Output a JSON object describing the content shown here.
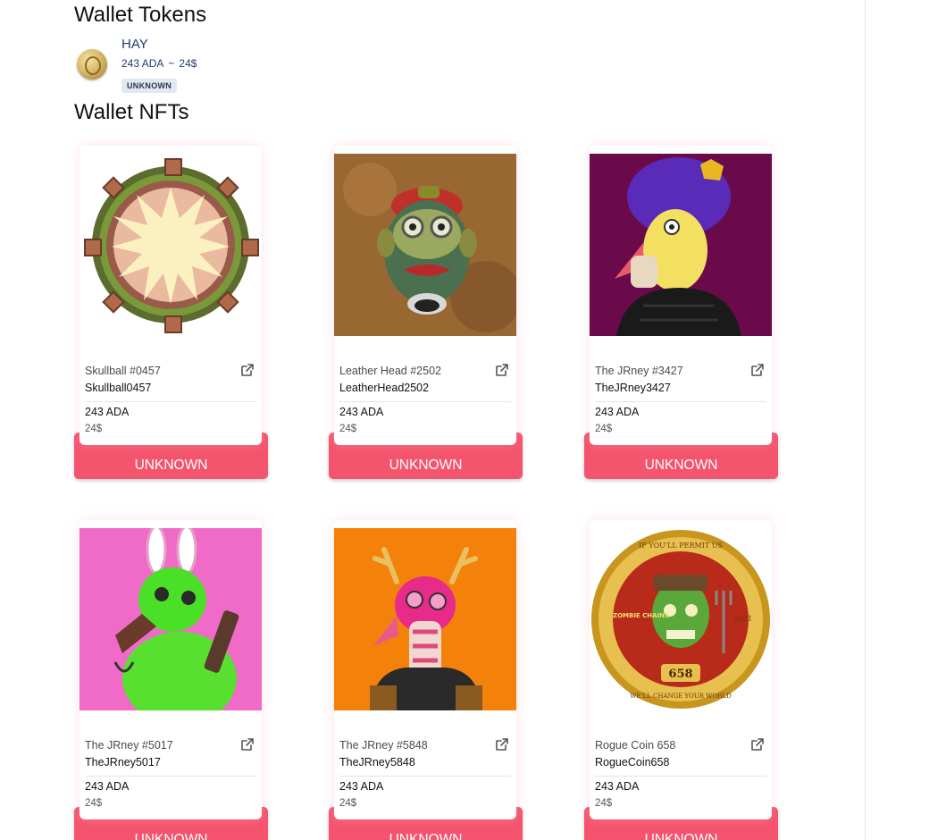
{
  "tokens_section": {
    "title": "Wallet Tokens",
    "token": {
      "name": "HAY",
      "ada": "243 ADA",
      "separator": "~",
      "usd": "24$",
      "badge": "UNKNOWN",
      "icon": "hay-coin-icon"
    }
  },
  "nfts_section": {
    "title": "Wallet NFTs",
    "items": [
      {
        "title": "Skullball #0457",
        "handle": "Skullball0457",
        "ada": "243 ADA",
        "usd": "24$",
        "button": "UNKNOWN",
        "image": "skullball-art"
      },
      {
        "title": "Leather Head #2502",
        "handle": "LeatherHead2502",
        "ada": "243 ADA",
        "usd": "24$",
        "button": "UNKNOWN",
        "image": "leather-ape-art"
      },
      {
        "title": "The JRney #3427",
        "handle": "TheJRney3427",
        "ada": "243 ADA",
        "usd": "24$",
        "button": "UNKNOWN",
        "image": "jrney-chicken-art"
      },
      {
        "title": "The JRney #5017",
        "handle": "TheJRney5017",
        "ada": "243 ADA",
        "usd": "24$",
        "button": "UNKNOWN",
        "image": "jrney-bunny-art"
      },
      {
        "title": "The JRney #5848",
        "handle": "TheJRney5848",
        "ada": "243 ADA",
        "usd": "24$",
        "button": "UNKNOWN",
        "image": "jrney-deer-art"
      },
      {
        "title": "Rogue Coin 658",
        "handle": "RogueCoin658",
        "ada": "243 ADA",
        "usd": "24$",
        "button": "UNKNOWN",
        "image": "rogue-coin-art",
        "image_text": {
          "top": "IF YOU'LL PERMIT US",
          "bottom": "WE'LL CHANGE YOUR WORLD",
          "number": "658",
          "brand": "ZOMBIE CHAINS",
          "year": "2021"
        }
      }
    ]
  },
  "colors": {
    "button": "#f4546d",
    "token_text": "#1f3b70",
    "badge_bg": "#e2e8f0"
  }
}
